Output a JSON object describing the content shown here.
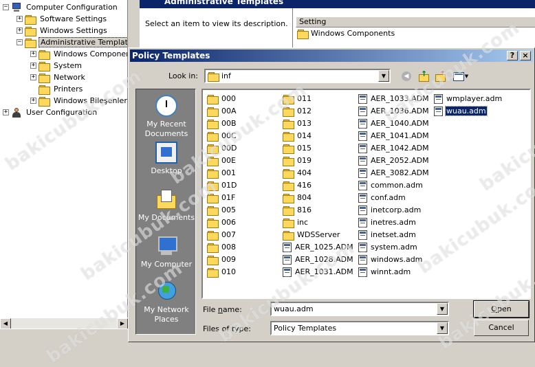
{
  "tree": {
    "items": [
      {
        "label": "Computer Configuration",
        "expander": "−",
        "icon": "computer-icon",
        "level": 0
      },
      {
        "label": "Software Settings",
        "expander": "+",
        "icon": "folder-icon",
        "level": 1
      },
      {
        "label": "Windows Settings",
        "expander": "+",
        "icon": "folder-icon",
        "level": 1
      },
      {
        "label": "Administrative Templates",
        "expander": "−",
        "icon": "folder-icon",
        "level": 1,
        "selected": true
      },
      {
        "label": "Windows Componer",
        "expander": "+",
        "icon": "folder-icon",
        "level": 2
      },
      {
        "label": "System",
        "expander": "+",
        "icon": "folder-icon",
        "level": 2
      },
      {
        "label": "Network",
        "expander": "+",
        "icon": "folder-icon",
        "level": 2
      },
      {
        "label": "Printers",
        "expander": "",
        "icon": "folder-icon",
        "level": 2
      },
      {
        "label": "Windows Bileşenleri",
        "expander": "+",
        "icon": "folder-icon",
        "level": 2
      },
      {
        "label": "User Configuration",
        "expander": "+",
        "icon": "user-icon",
        "level": 0
      }
    ]
  },
  "background_window": {
    "title": "Administrative Templates",
    "description": "Select an item to view its description.",
    "column_header": "Setting",
    "row_label": "Windows Components"
  },
  "dialog": {
    "title": "Policy Templates",
    "help_label": "?",
    "close_label": "×",
    "look_in_label": "Look in:",
    "look_in_value": "inf",
    "places": [
      {
        "label": "My Recent Documents",
        "icon": "recent-documents-icon"
      },
      {
        "label": "Desktop",
        "icon": "desktop-icon"
      },
      {
        "label": "My Documents",
        "icon": "my-documents-icon"
      },
      {
        "label": "My Computer",
        "icon": "my-computer-icon"
      },
      {
        "label": "My Network Places",
        "icon": "network-places-icon"
      }
    ],
    "files": {
      "col1": [
        "000",
        "00A",
        "00B",
        "00C",
        "00D",
        "00E",
        "001",
        "01D",
        "01F",
        "005",
        "006",
        "007",
        "008",
        "009",
        "010"
      ],
      "col2": [
        "011",
        "012",
        "013",
        "014",
        "015",
        "019",
        "404",
        "416",
        "804",
        "816",
        "inc",
        "WDSServer",
        "AER_1025.ADM",
        "AER_1028.ADM",
        "AER_1031.ADM"
      ],
      "col3": [
        "AER_1033.ADM",
        "AER_1036.ADM",
        "AER_1040.ADM",
        "AER_1041.ADM",
        "AER_1042.ADM",
        "AER_2052.ADM",
        "AER_3082.ADM",
        "common.adm",
        "conf.adm",
        "inetcorp.adm",
        "inetres.adm",
        "inetset.adm",
        "system.adm",
        "windows.adm",
        "winnt.adm"
      ],
      "col4": [
        "wmplayer.adm",
        "wuau.adm"
      ],
      "col2_folder_count": 12,
      "selected": "wuau.adm"
    },
    "file_name_label": "File name:",
    "file_name_value": "wuau.adm",
    "files_of_type_label": "Files of type:",
    "files_of_type_value": "Policy Templates",
    "open_label": "Open",
    "cancel_label": "Cancel"
  },
  "watermark": "bakicubuk.com"
}
